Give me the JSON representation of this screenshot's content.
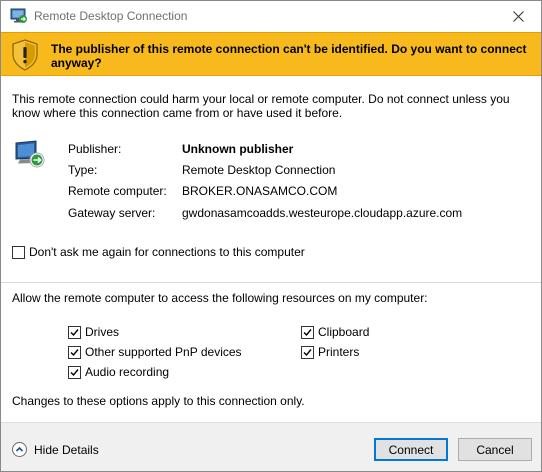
{
  "window": {
    "title": "Remote Desktop Connection"
  },
  "banner": {
    "message": "The publisher of this remote connection can't be identified. Do you want to connect anyway?"
  },
  "warning_text": "This remote connection could harm your local or remote computer. Do not connect unless you know where this connection came from or have used it before.",
  "info": {
    "publisher_label": "Publisher:",
    "publisher_value": "Unknown publisher",
    "type_label": "Type:",
    "type_value": "Remote Desktop Connection",
    "remote_label": "Remote computer:",
    "remote_value": "BROKER.ONASAMCO.COM",
    "gateway_label": "Gateway server:",
    "gateway_value": "gwdonasamcoadds.westeurope.cloudapp.azure.com"
  },
  "dont_ask": {
    "label": "Don't ask me again for connections to this computer",
    "checked": false
  },
  "resources": {
    "header": "Allow the remote computer to access the following resources on my computer:",
    "drives": {
      "label": "Drives",
      "checked": true
    },
    "clipboard": {
      "label": "Clipboard",
      "checked": true
    },
    "pnp": {
      "label": "Other supported PnP devices",
      "checked": true
    },
    "printers": {
      "label": "Printers",
      "checked": true
    },
    "audio": {
      "label": "Audio recording",
      "checked": true
    },
    "note": "Changes to these options apply to this connection only."
  },
  "footer": {
    "hide_details": "Hide Details",
    "connect": "Connect",
    "cancel": "Cancel"
  },
  "colors": {
    "banner": "#f8b91d",
    "footer": "#f0f0f0",
    "accent": "#0078d7"
  }
}
